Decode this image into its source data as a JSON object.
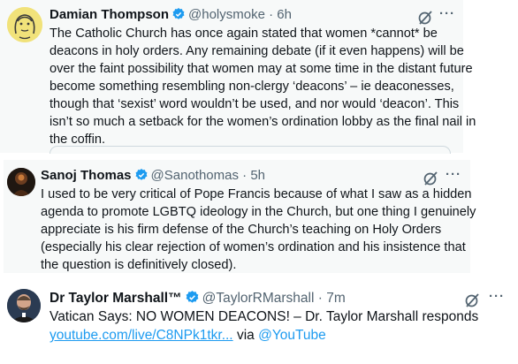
{
  "tweets": [
    {
      "name": "Damian Thompson",
      "handle": "@holysmoke",
      "time": "6h",
      "lines": [
        "The Catholic Church has once again stated that women *cannot* be",
        "deacons in holy orders. Any remaining debate (if it even happens) will be",
        "over the faint possibility that women may at some time in the distant future",
        "become something resembling non-clergy ‘deacons’ – ie deaconesses,",
        "though that ‘sexist’ word wouldn’t be used, and nor would ‘deacon’. This",
        "isn’t so much a setback for the women’s ordination lobby as the final nail in",
        "the coffin."
      ]
    },
    {
      "name": "Sanoj Thomas",
      "handle": "@Sanothomas",
      "time": "5h",
      "lines": [
        "I used to be very critical of Pope Francis because of what I saw as a hidden",
        "agenda to promote LGBTQ ideology in the Church, but one thing I genuinely",
        "appreciate is his firm defense of the Church’s teaching on Holy Orders",
        "(especially his clear rejection of women’s ordination and his insistence that",
        "the question is definitively closed)."
      ]
    },
    {
      "name": "Dr Taylor Marshall™",
      "handle": "@TaylorRMarshall",
      "time": "7m",
      "line1": "Vatican Says: NO WOMEN DEACONS! – Dr. Taylor Marshall responds",
      "link": "youtube.com/live/C8NPk1tkr...",
      "via": "via",
      "mention": "@YouTube"
    }
  ],
  "separator": "·",
  "more_glyph": "···",
  "icons": [
    "grok-icon",
    "more-icon",
    "verified-badge-icon"
  ],
  "colors": {
    "verified": "#1d9bf0",
    "link": "#1d9bf0",
    "muted": "#536471",
    "card_bg": "#f7f9f9"
  }
}
